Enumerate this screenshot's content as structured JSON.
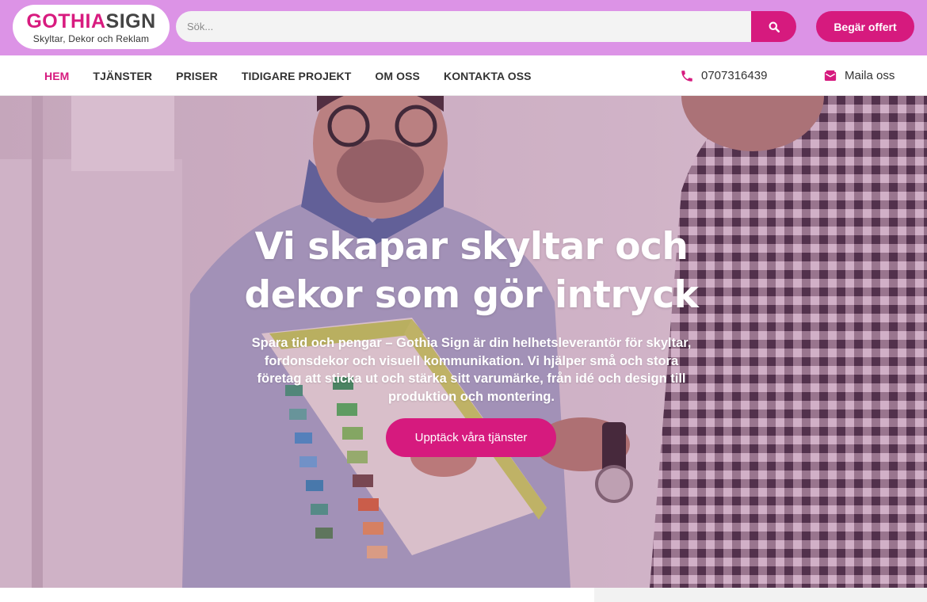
{
  "brand": {
    "name_part1": "GOTHIA",
    "name_part2": "SIGN",
    "tagline": "Skyltar, Dekor och Reklam",
    "primary_color": "#d61a7e",
    "topbar_color": "#dc93e6"
  },
  "search": {
    "placeholder": "Sök...",
    "icon": "search-icon"
  },
  "header": {
    "quote_button": "Begär offert"
  },
  "nav": {
    "items": [
      {
        "label": "HEM",
        "active": true
      },
      {
        "label": "TJÄNSTER",
        "active": false
      },
      {
        "label": "PRISER",
        "active": false
      },
      {
        "label": "TIDIGARE PROJEKT",
        "active": false
      },
      {
        "label": "OM OSS",
        "active": false
      },
      {
        "label": "KONTAKTA OSS",
        "active": false
      }
    ],
    "phone": {
      "icon": "phone-icon",
      "number": "0707316439"
    },
    "mail": {
      "icon": "envelope-icon",
      "label": "Maila oss"
    }
  },
  "hero": {
    "title": "Vi skapar skyltar och dekor som gör intryck",
    "text": "Spara tid och pengar – Gothia Sign är din helhetsleverantör för skyltar, fordonsdekor och visuell kommunikation. Vi hjälper små och stora företag att sticka ut och stärka sitt varumärke, från idé och design till produktion och montering.",
    "cta": "Upptäck våra tjänster",
    "background": "photo of two men reviewing a color palette sheet"
  }
}
